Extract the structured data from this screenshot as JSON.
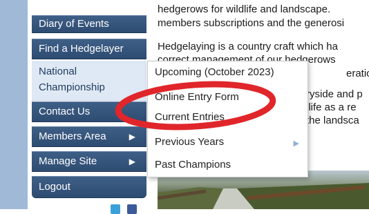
{
  "sidebar": {
    "items": [
      {
        "label": "Diary of Events"
      },
      {
        "label": "Find a Hedgelayer"
      },
      {
        "label": "National Championship"
      },
      {
        "label": "Contact Us"
      },
      {
        "label": "Members Area",
        "submenu_arrow": "▶"
      },
      {
        "label": "Manage Site",
        "submenu_arrow": "▶"
      },
      {
        "label": "Logout"
      }
    ]
  },
  "content": {
    "paragraph1": [
      "hedgerows for wildlife and landscape.",
      "members subscriptions and the generosi"
    ],
    "paragraph2": [
      "Hedgelaying is a country craft which ha",
      "correct management of our hedgerows",
      "erations."
    ],
    "paragraph3": [
      "ryside and p",
      "llife as a re",
      " the landsca"
    ]
  },
  "dropdown": {
    "items": [
      {
        "label": "Upcoming (October 2023)"
      },
      {
        "label": "Online Entry Form"
      },
      {
        "label": "Current Entries"
      },
      {
        "label": "Previous Years",
        "submenu_arrow": "▶"
      },
      {
        "label": "Past Champions"
      }
    ]
  },
  "annotation": {
    "shape": "ellipse",
    "color": "#e0262b",
    "target": "Online Entry Form"
  },
  "colors": {
    "nav_bg": "#36567d",
    "nav_active_bg": "#dfe9f5",
    "left_band": "#9fb9d7",
    "highlight_circle": "#e0262b"
  }
}
